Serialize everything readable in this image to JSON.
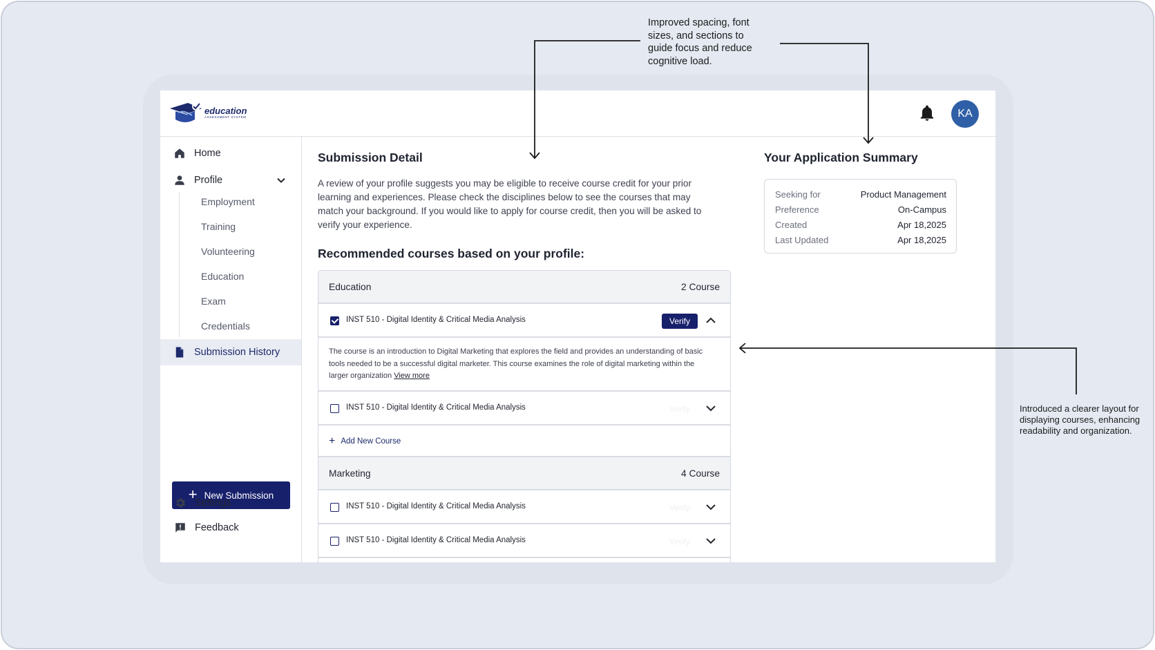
{
  "app": {
    "logo_main": "education",
    "logo_sub": "ASSESSMENT SYSTEM",
    "avatar_initials": "KA"
  },
  "sidebar": {
    "home": "Home",
    "profile": "Profile",
    "sub_items": [
      "Employment",
      "Training",
      "Volunteering",
      "Education",
      "Exam",
      "Credentials"
    ],
    "submission_history": "Submission History",
    "new_submission": "New Submission",
    "settings": "Settings",
    "feedback": "Feedback"
  },
  "main": {
    "title": "Submission Detail",
    "description": "A review of your profile suggests you may be eligible to receive course credit for your prior learning and experiences. Please check the disciplines below to see the courses that may match your background. If you would like to apply for course credit, then you will be asked to verify your experience.",
    "recommended_title": "Recommended courses based on your profile:",
    "groups": [
      {
        "name": "Education",
        "count": "2 Course",
        "courses": [
          {
            "name": "INST 510 - Digital Identity & Critical Media Analysis",
            "checked": true,
            "expanded": true,
            "verify": "Verify"
          },
          {
            "name": "INST 510 - Digital Identity & Critical Media Analysis",
            "checked": false,
            "expanded": false,
            "verify": "Verify"
          }
        ],
        "detail": "The course is an introduction to Digital Marketing that explores the field and provides an understanding of basic tools needed to be a successful digital marketer. This course examines the role of digital marketing within the larger organization",
        "view_more": "View more",
        "add_course": "Add New Course"
      },
      {
        "name": "Marketing",
        "count": "4 Course",
        "courses": [
          {
            "name": "INST 510 - Digital Identity & Critical Media Analysis",
            "checked": false,
            "expanded": false,
            "verify": "Verify"
          },
          {
            "name": "INST 510 - Digital Identity & Critical Media Analysis",
            "checked": false,
            "expanded": false,
            "verify": "Verify"
          }
        ]
      }
    ]
  },
  "summary": {
    "title": "Your Application Summary",
    "rows": [
      {
        "label": "Seeking for",
        "value": "Product Management"
      },
      {
        "label": "Preference",
        "value": "On-Campus"
      },
      {
        "label": "Created",
        "value": "Apr 18,2025"
      },
      {
        "label": "Last Updated",
        "value": "Apr 18,2025"
      }
    ]
  },
  "annotations": {
    "top": "Improved spacing, font sizes, and sections to guide focus and reduce cognitive load.",
    "right": "Introduced a clearer layout for displaying courses, enhancing readability and organization."
  },
  "colors": {
    "primary": "#17206b",
    "avatar": "#2f5fa6",
    "canvas": "#e4e9f2"
  },
  "icons": [
    "bell-icon",
    "home-icon",
    "user-icon",
    "chevron-down-icon",
    "document-icon",
    "plus-icon",
    "gear-icon",
    "feedback-icon",
    "chevron-up-icon",
    "graduation-cap-icon"
  ]
}
